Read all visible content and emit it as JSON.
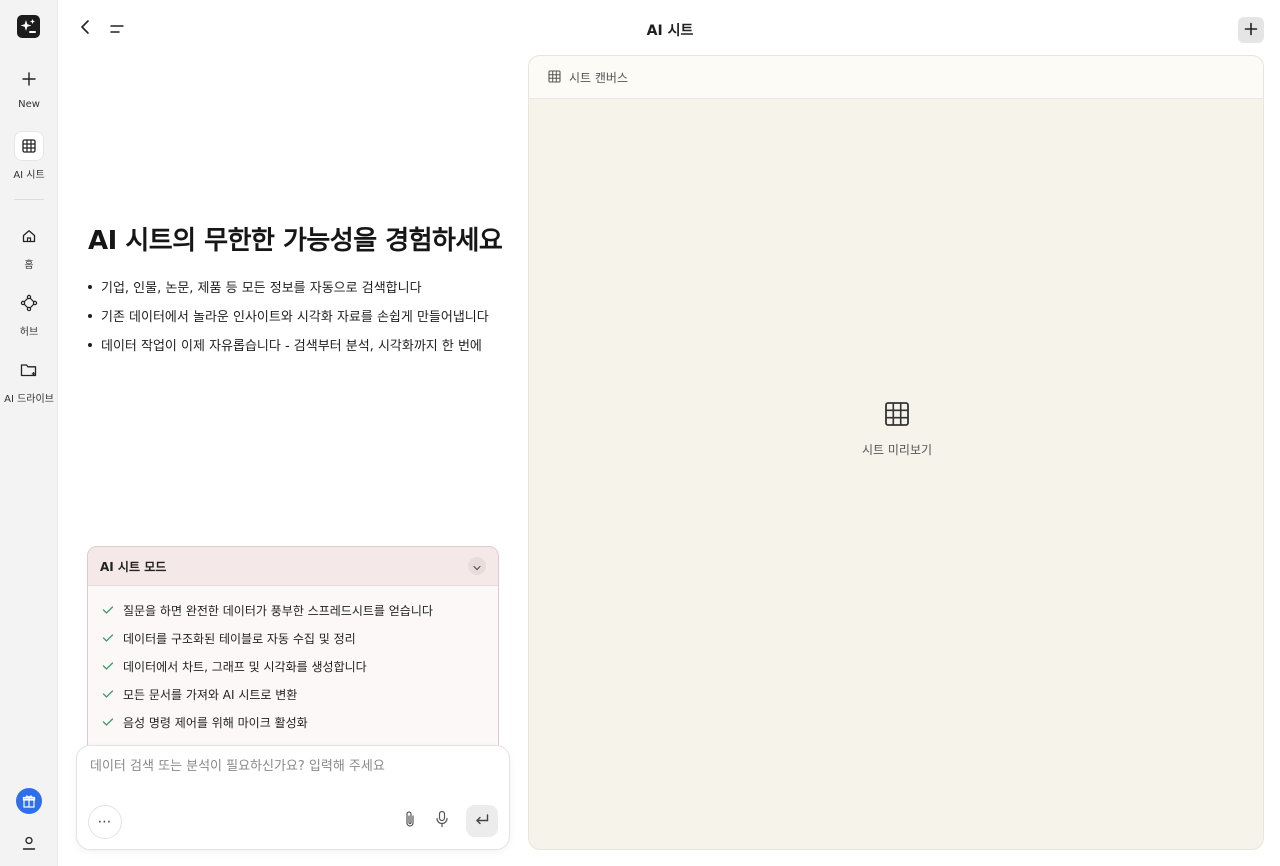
{
  "app": {
    "title": "AI 시트"
  },
  "sidebar": {
    "logo_icon": "sparkle-logo-icon",
    "items": [
      {
        "label": "New",
        "icon": "plus-icon"
      },
      {
        "label": "AI 시트",
        "icon": "grid-icon",
        "active": true
      },
      {
        "label": "홈",
        "icon": "home-icon"
      },
      {
        "label": "허브",
        "icon": "hub-icon"
      },
      {
        "label": "AI 드라이브",
        "icon": "folder-icon"
      }
    ],
    "bottom": [
      {
        "icon": "gift-icon",
        "color": "#2f6fed"
      },
      {
        "icon": "user-icon"
      }
    ]
  },
  "hero": {
    "title": "AI 시트의 무한한 가능성을 경험하세요",
    "bullets": [
      "기업, 인물, 논문, 제품 등 모든 정보를 자동으로 검색합니다",
      "기존 데이터에서 놀라운 인사이트와 시각화 자료를 손쉽게 만들어냅니다",
      "데이터 작업이 이제 자유롭습니다 - 검색부터 분석, 시각화까지 한 번에"
    ]
  },
  "mode": {
    "title": "AI 시트 모드",
    "items": [
      "질문을 하면 완전한 데이터가 풍부한 스프레드시트를 얻습니다",
      "데이터를 구조화된 테이블로 자동 수집 및 정리",
      "데이터에서 차트, 그래프 및 시각화를 생성합니다",
      "모든 문서를 가져와 AI 시트로 변환",
      "음성 명령 제어를 위해 마이크 활성화"
    ],
    "check_color": "#3a9a6a"
  },
  "composer": {
    "placeholder": "데이터 검색 또는 분석이 필요하신가요? 입력해 주세요",
    "value": "",
    "more_label": "⋯"
  },
  "canvas": {
    "header_label": "시트 캔버스",
    "preview_label": "시트 미리보기",
    "background": "#f6f4ea"
  }
}
